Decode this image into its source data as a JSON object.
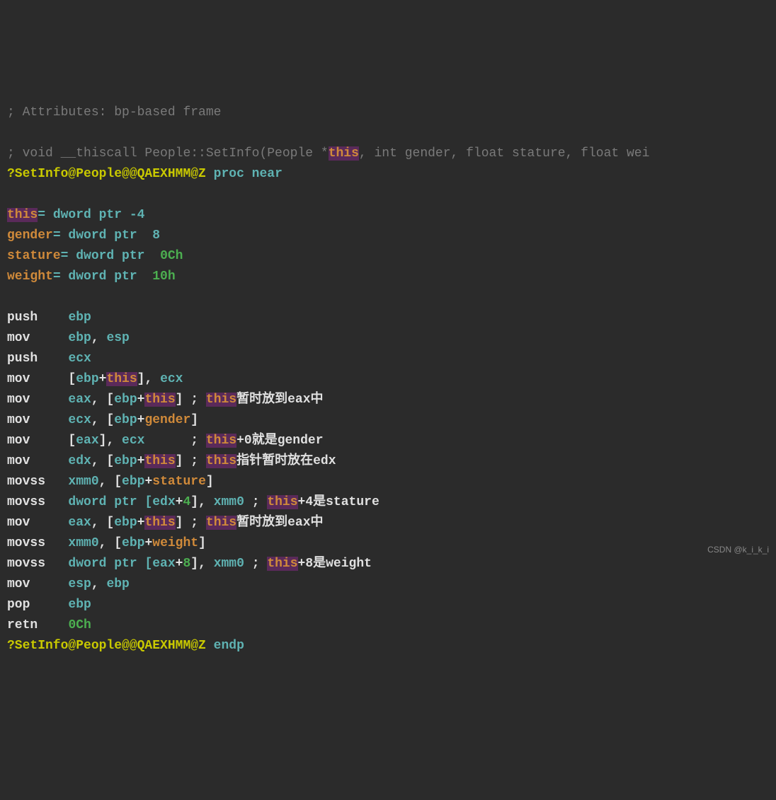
{
  "lines": {
    "l00a": "; Attributes: bp-based frame",
    "l01a": "; void __thiscall People::SetInfo(People *",
    "l01b": "this",
    "l01c": ", int gender, float stature, float wei",
    "l02a": "?SetInfo@People@@QAEXHMM@Z",
    "l02b": " proc near",
    "l04a": "this",
    "l04b": "= dword ptr -4",
    "l05a": "gender",
    "l05b": "= dword ptr  8",
    "l06a": "stature",
    "l06b": "= dword ptr  ",
    "l06c": "0Ch",
    "l07a": "weight",
    "l07b": "= dword ptr  ",
    "l07c": "10h",
    "l09a": "push",
    "l09b": "ebp",
    "l10a": "mov",
    "l10b": "ebp",
    "l10c": ", ",
    "l10d": "esp",
    "l11a": "push",
    "l11b": "ecx",
    "l12a": "mov",
    "l12b": "[",
    "l12c": "ebp",
    "l12d": "+",
    "l12e": "this",
    "l12f": "], ",
    "l12g": "ecx",
    "l13a": "mov",
    "l13b": "eax",
    "l13c": ", [",
    "l13d": "ebp",
    "l13e": "+",
    "l13f": "this",
    "l13g": "] ; ",
    "l13h": "this",
    "l13i": "暂时放到eax中",
    "l14a": "mov",
    "l14b": "ecx",
    "l14c": ", [",
    "l14d": "ebp",
    "l14e": "+",
    "l14f": "gender",
    "l14g": "]",
    "l15a": "mov",
    "l15b": "[",
    "l15c": "eax",
    "l15d": "], ",
    "l15e": "ecx",
    "l15f": "      ; ",
    "l15g": "this",
    "l15h": "+0就是gender",
    "l16a": "mov",
    "l16b": "edx",
    "l16c": ", [",
    "l16d": "ebp",
    "l16e": "+",
    "l16f": "this",
    "l16g": "] ; ",
    "l16h": "this",
    "l16i": "指针暂时放在edx",
    "l17a": "movss",
    "l17b": "xmm0",
    "l17c": ", [",
    "l17d": "ebp",
    "l17e": "+",
    "l17f": "stature",
    "l17g": "]",
    "l18a": "movss",
    "l18b": "dword ptr [",
    "l18c": "edx",
    "l18d": "+",
    "l18e": "4",
    "l18f": "], ",
    "l18g": "xmm0",
    "l18h": " ; ",
    "l18i": "this",
    "l18j": "+4是stature",
    "l19a": "mov",
    "l19b": "eax",
    "l19c": ", [",
    "l19d": "ebp",
    "l19e": "+",
    "l19f": "this",
    "l19g": "] ; ",
    "l19h": "this",
    "l19i": "暂时放到eax中",
    "l20a": "movss",
    "l20b": "xmm0",
    "l20c": ", [",
    "l20d": "ebp",
    "l20e": "+",
    "l20f": "weight",
    "l20g": "]",
    "l21a": "movss",
    "l21b": "dword ptr [",
    "l21c": "eax",
    "l21d": "+",
    "l21e": "8",
    "l21f": "], ",
    "l21g": "xmm0",
    "l21h": " ; ",
    "l21i": "this",
    "l21j": "+8是weight",
    "l22a": "mov",
    "l22b": "esp",
    "l22c": ", ",
    "l22d": "ebp",
    "l23a": "pop",
    "l23b": "ebp",
    "l24a": "retn",
    "l24b": "0Ch",
    "l25a": "?SetInfo@People@@QAEXHMM@Z",
    "l25b": " endp"
  },
  "watermark": "CSDN @k_i_k_i"
}
